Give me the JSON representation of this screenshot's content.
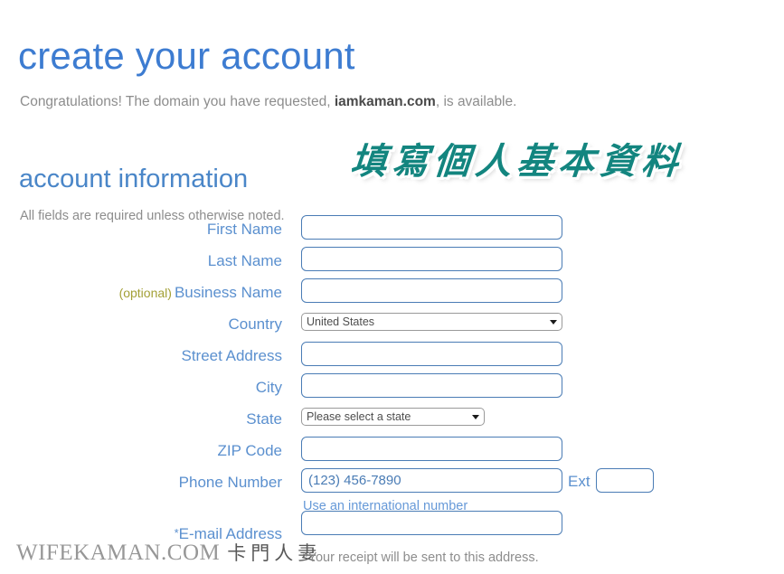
{
  "page": {
    "title": "create your account",
    "congratulations_prefix": "Congratulations! The domain you have requested, ",
    "domain": "iamkaman.com",
    "congratulations_suffix": ", is available.",
    "section_title": "account information",
    "all_fields_note": "All fields are required unless otherwise noted."
  },
  "annotation": {
    "chinese_overlay": "填寫個人基本資料",
    "overlay_color": "#13857f"
  },
  "watermark": {
    "site": "WIFEKAMAN.COM",
    "chinese": "卡門人妻"
  },
  "theme": {
    "heading_blue": "#3d7cd1",
    "label_blue": "#5b90cf",
    "input_border_blue": "#4a7cb5",
    "optional_olive": "#a3a036",
    "muted_gray": "#8d8d8d"
  },
  "form": {
    "optional_tag": "(optional)",
    "fields": [
      {
        "id": "first-name",
        "label": "First Name",
        "type": "text",
        "value": "",
        "placeholder": ""
      },
      {
        "id": "last-name",
        "label": "Last Name",
        "type": "text",
        "value": "",
        "placeholder": ""
      },
      {
        "id": "business-name",
        "label": "Business Name",
        "type": "text",
        "value": "",
        "placeholder": "",
        "optional": true
      },
      {
        "id": "country",
        "label": "Country",
        "type": "select",
        "value": "United States"
      },
      {
        "id": "street-address",
        "label": "Street Address",
        "type": "text",
        "value": "",
        "placeholder": ""
      },
      {
        "id": "city",
        "label": "City",
        "type": "text",
        "value": "",
        "placeholder": ""
      },
      {
        "id": "state",
        "label": "State",
        "type": "select",
        "value": "Please select a state"
      },
      {
        "id": "zip-code",
        "label": "ZIP Code",
        "type": "text",
        "value": "",
        "placeholder": ""
      },
      {
        "id": "phone-number",
        "label": "Phone Number",
        "type": "text",
        "value": "",
        "placeholder": "(123) 456-7890"
      },
      {
        "id": "email-address",
        "label": "E-mail Address",
        "type": "text",
        "value": "",
        "placeholder": "",
        "required_star": "*"
      }
    ],
    "ext_label": "Ext",
    "ext_value": "",
    "international_link": "Use an international number",
    "email_note": "*Your receipt will be sent to this address."
  }
}
